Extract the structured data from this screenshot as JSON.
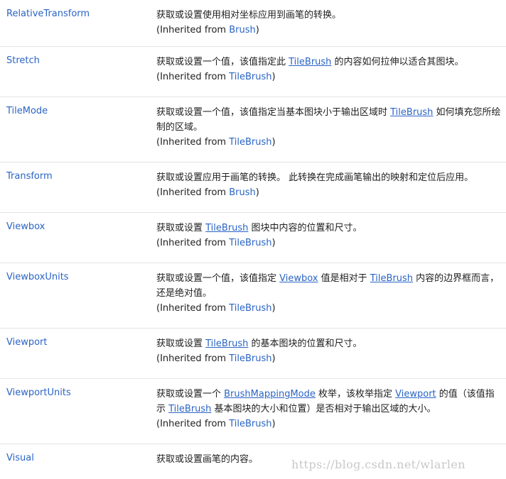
{
  "rows": [
    {
      "name": "RelativeTransform",
      "desc": [
        {
          "t": "获取或设置使用相对坐标应用到画笔的转换。"
        }
      ],
      "inherited_prefix": "(Inherited from ",
      "inherited_link": "Brush",
      "inherited_suffix": ")"
    },
    {
      "name": "Stretch",
      "desc": [
        {
          "t": "获取或设置一个值，该值指定此 "
        },
        {
          "t": "TileBrush",
          "link": true
        },
        {
          "t": " 的内容如何拉伸以适合其图块。"
        }
      ],
      "inherited_prefix": "(Inherited from ",
      "inherited_link": "TileBrush",
      "inherited_suffix": ")"
    },
    {
      "name": "TileMode",
      "desc": [
        {
          "t": "获取或设置一个值，该值指定当基本图块小于输出区域时 "
        },
        {
          "t": "TileBrush",
          "link": true
        },
        {
          "t": " 如何填充您所绘制的区域。"
        }
      ],
      "inherited_prefix": "(Inherited from ",
      "inherited_link": "TileBrush",
      "inherited_suffix": ")"
    },
    {
      "name": "Transform",
      "desc": [
        {
          "t": "获取或设置应用于画笔的转换。 此转换在完成画笔输出的映射和定位后应用。"
        }
      ],
      "inherited_prefix": "(Inherited from ",
      "inherited_link": "Brush",
      "inherited_suffix": ")"
    },
    {
      "name": "Viewbox",
      "desc": [
        {
          "t": "获取或设置 "
        },
        {
          "t": "TileBrush",
          "link": true
        },
        {
          "t": " 图块中内容的位置和尺寸。"
        }
      ],
      "inherited_prefix": "(Inherited from ",
      "inherited_link": "TileBrush",
      "inherited_suffix": ")"
    },
    {
      "name": "ViewboxUnits",
      "desc": [
        {
          "t": "获取或设置一个值，该值指定 "
        },
        {
          "t": "Viewbox",
          "link": true
        },
        {
          "t": " 值是相对于 "
        },
        {
          "t": "TileBrush",
          "link": true
        },
        {
          "t": " 内容的边界框而言，还是绝对值。"
        }
      ],
      "inherited_prefix": "(Inherited from ",
      "inherited_link": "TileBrush",
      "inherited_suffix": ")"
    },
    {
      "name": "Viewport",
      "desc": [
        {
          "t": "获取或设置 "
        },
        {
          "t": "TileBrush",
          "link": true
        },
        {
          "t": " 的基本图块的位置和尺寸。"
        }
      ],
      "inherited_prefix": "(Inherited from ",
      "inherited_link": "TileBrush",
      "inherited_suffix": ")"
    },
    {
      "name": "ViewportUnits",
      "desc": [
        {
          "t": "获取或设置一个 "
        },
        {
          "t": "BrushMappingMode",
          "link": true
        },
        {
          "t": " 枚举，该枚举指定 "
        },
        {
          "t": "Viewport",
          "link": true
        },
        {
          "t": " 的值（该值指示 "
        },
        {
          "t": "TileBrush",
          "link": true
        },
        {
          "t": " 基本图块的大小和位置）是否相对于输出区域的大小。"
        }
      ],
      "inherited_prefix": "(Inherited from ",
      "inherited_link": "TileBrush",
      "inherited_suffix": ")"
    },
    {
      "name": "Visual",
      "desc": [
        {
          "t": "获取或设置画笔的内容。"
        }
      ],
      "inherited_prefix": "",
      "inherited_link": "",
      "inherited_suffix": ""
    }
  ],
  "watermark": "https://blog.csdn.net/wlarlen",
  "colors": {
    "link": "#2a64c5",
    "text": "#1e1e1e",
    "divider": "#e3e3e3",
    "watermark": "#c8c8c8"
  }
}
